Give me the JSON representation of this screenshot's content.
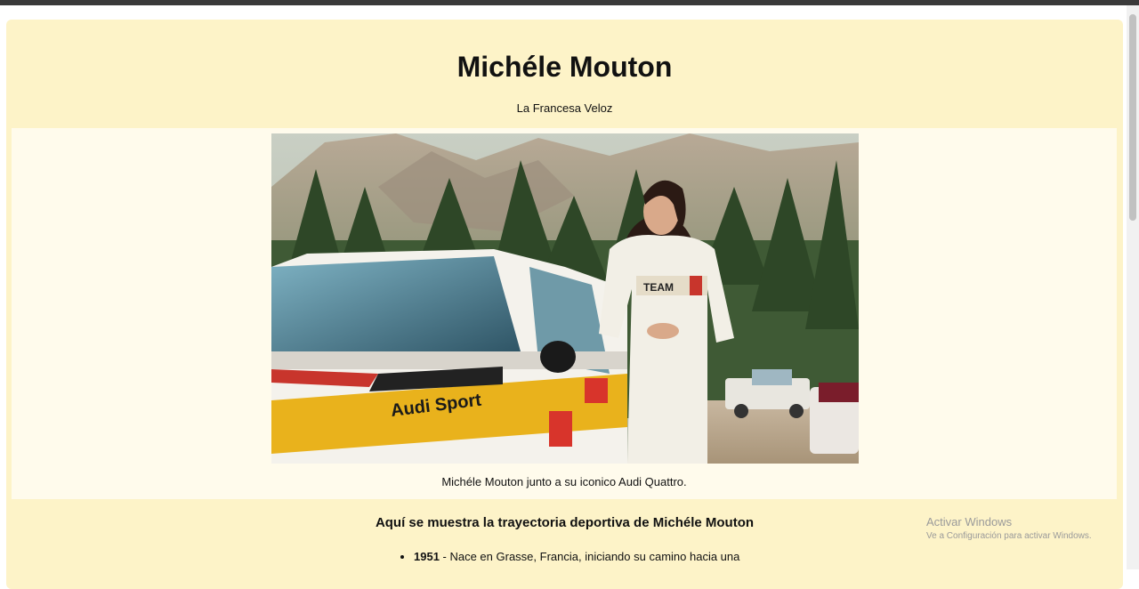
{
  "page": {
    "title": "Michéle Mouton",
    "tagline": "La Francesa Veloz"
  },
  "figure": {
    "caption": "Michéle Mouton junto a su iconico Audi Quattro.",
    "car_decal": "Audi Sport",
    "suit_text": "TEAM",
    "bg_color": "#fffbec"
  },
  "timeline": {
    "heading": "Aquí se muestra la trayectoria deportiva de Michéle Mouton",
    "items": [
      {
        "year": "1951",
        "text": " - Nace en Grasse, Francia, iniciando su camino hacia una"
      }
    ]
  },
  "windows_watermark": {
    "line1": "Activar Windows",
    "line2": "Ve a Configuración para activar Windows."
  },
  "colors": {
    "page_bg": "#fdf3c8",
    "accent_yellow": "#e9b21c"
  }
}
